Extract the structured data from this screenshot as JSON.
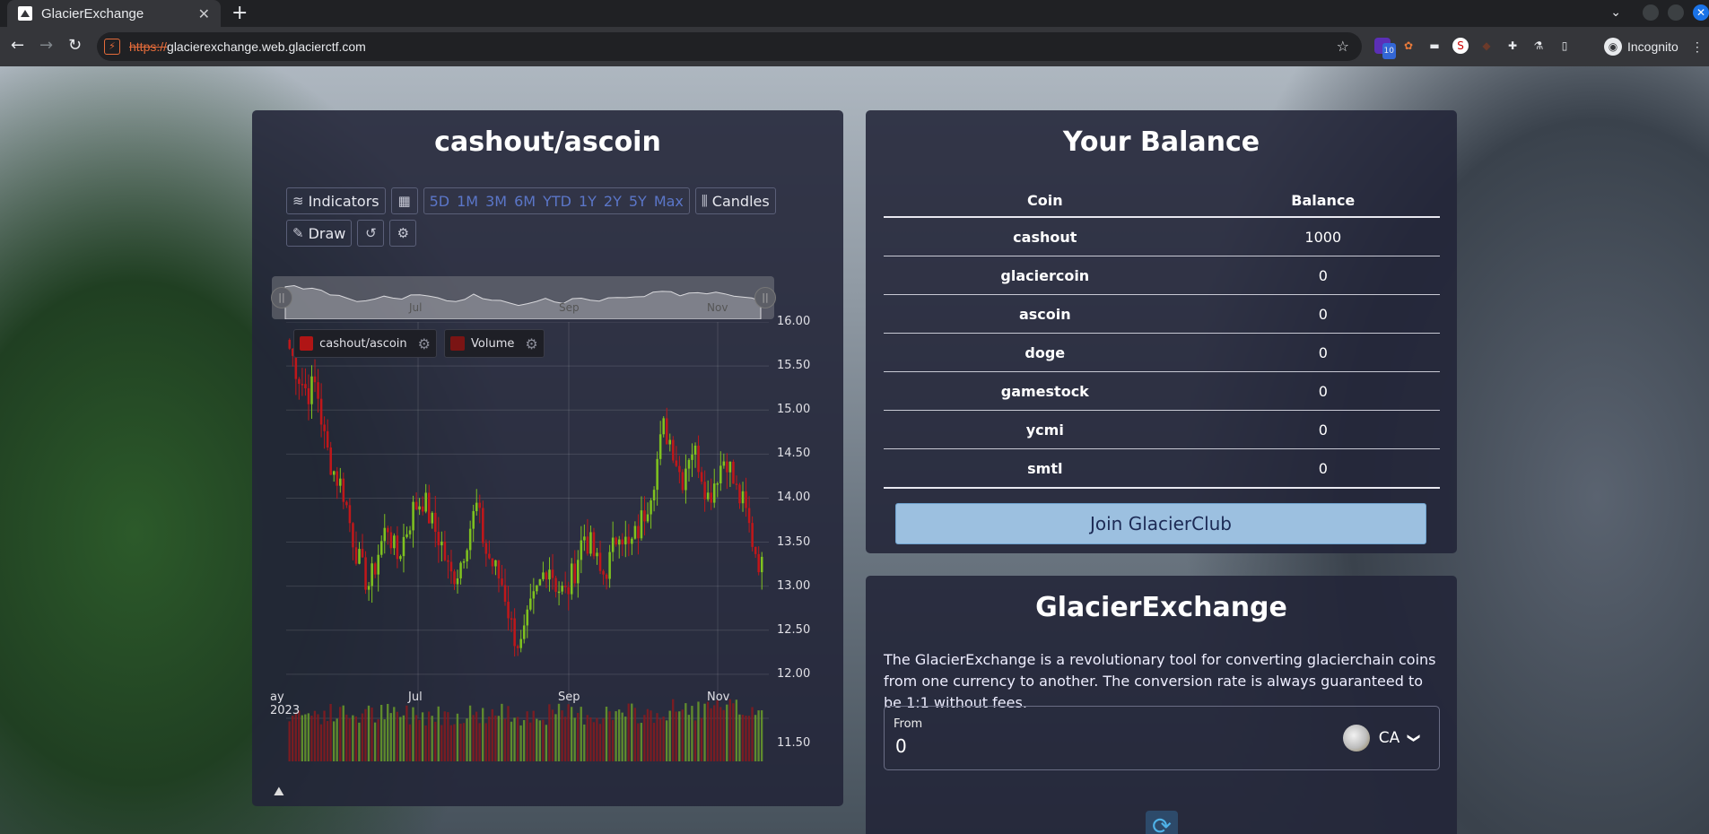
{
  "browser": {
    "tab_title": "GlacierExchange",
    "url_scheme": "https://",
    "url_rest": "glacierexchange.web.glacierctf.com",
    "profile_label": "Incognito",
    "extension_badge": "10"
  },
  "chart_panel": {
    "title": "cashout/ascoin",
    "indicators_label": "Indicators",
    "ranges": [
      "5D",
      "1M",
      "3M",
      "6M",
      "YTD",
      "1Y",
      "2Y",
      "5Y",
      "Max"
    ],
    "candles_label": "Candles",
    "draw_label": "Draw",
    "navigator_labels": [
      "Jul",
      "Sep",
      "Nov"
    ],
    "legend_price": "cashout/ascoin",
    "legend_volume": "Volume"
  },
  "chart_data": {
    "type": "candlestick",
    "series_name": "cashout/ascoin",
    "volume_series_name": "Volume",
    "x_ticks": [
      "ay 2023",
      "Jul",
      "Sep",
      "Nov"
    ],
    "y_ticks": [
      "16.00",
      "15.50",
      "15.00",
      "14.50",
      "14.00",
      "13.50",
      "13.00",
      "12.50",
      "12.00",
      "11.50"
    ],
    "ylim": [
      11.5,
      16.0
    ],
    "close_path": [
      15.7,
      15.4,
      15.2,
      15.3,
      14.6,
      14.3,
      14.1,
      13.6,
      13.2,
      13.0,
      13.4,
      13.7,
      13.3,
      13.6,
      13.9,
      14.0,
      13.7,
      13.5,
      13.1,
      13.2,
      13.6,
      13.9,
      13.4,
      13.2,
      13.0,
      12.5,
      12.3,
      12.7,
      13.0,
      13.3,
      13.0,
      12.9,
      13.2,
      13.6,
      13.4,
      13.1,
      13.3,
      13.7,
      13.4,
      13.6,
      13.9,
      14.3,
      14.8,
      14.6,
      14.2,
      14.6,
      14.4,
      14.0,
      14.3,
      14.5,
      14.1,
      13.9,
      13.5,
      13.2
    ],
    "up_color": "#7fc21f",
    "down_color": "#c0171a",
    "grid": true
  },
  "balance": {
    "title": "Your Balance",
    "col_coin": "Coin",
    "col_balance": "Balance",
    "rows": [
      {
        "coin": "cashout",
        "balance": "1000"
      },
      {
        "coin": "glaciercoin",
        "balance": "0"
      },
      {
        "coin": "ascoin",
        "balance": "0"
      },
      {
        "coin": "doge",
        "balance": "0"
      },
      {
        "coin": "gamestock",
        "balance": "0"
      },
      {
        "coin": "ycmi",
        "balance": "0"
      },
      {
        "coin": "smtl",
        "balance": "0"
      }
    ],
    "join_label": "Join GlacierClub"
  },
  "exchange": {
    "title": "GlacierExchange",
    "description": "The GlacierExchange is a revolutionary tool for converting glacierchain coins from one currency to another. The conversion rate is always guaranteed to be 1:1 without fees.",
    "from_label": "From",
    "from_value": "0",
    "from_coin": "CA"
  }
}
